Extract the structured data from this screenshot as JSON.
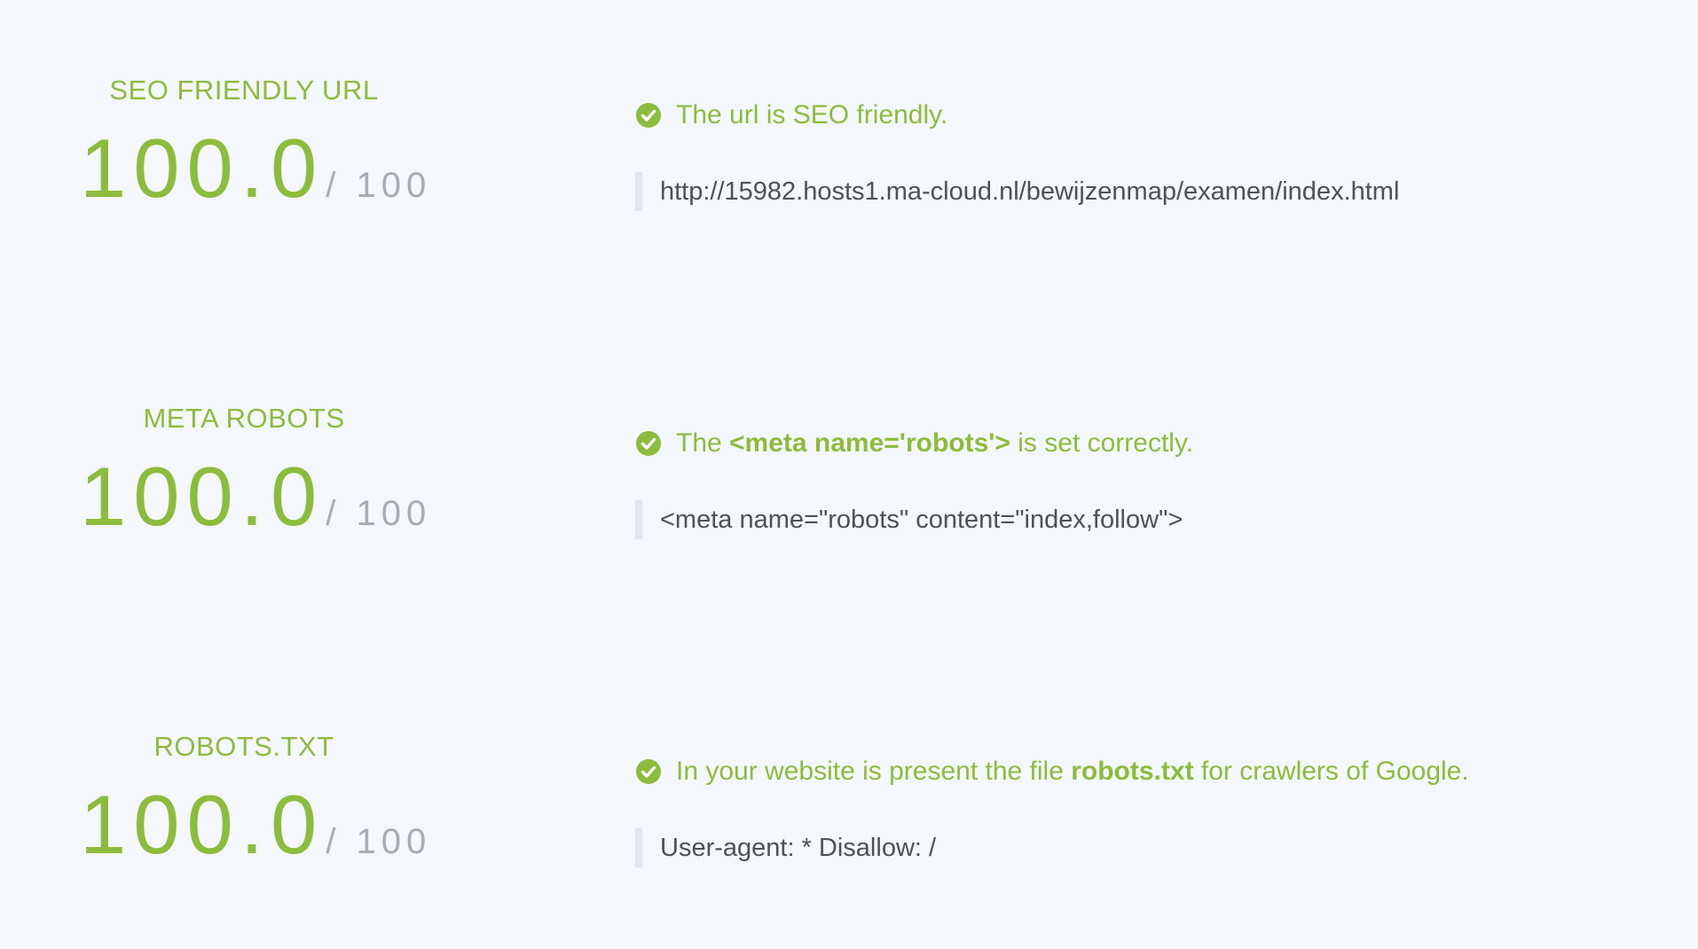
{
  "sections": [
    {
      "title": "SEO FRIENDLY URL",
      "score": "100.0",
      "max": "/ 100",
      "status": {
        "prefix": "The url is SEO friendly.",
        "bold": "",
        "suffix": ""
      },
      "code": "http://15982.hosts1.ma-cloud.nl/bewijzenmap/examen/index.html"
    },
    {
      "title": "META ROBOTS",
      "score": "100.0",
      "max": "/ 100",
      "status": {
        "prefix": "The ",
        "bold": "<meta name='robots'>",
        "suffix": " is set correctly."
      },
      "code": "<meta name=\"robots\" content=\"index,follow\">"
    },
    {
      "title": "ROBOTS.TXT",
      "score": "100.0",
      "max": "/ 100",
      "status": {
        "prefix": "In your website is present the file ",
        "bold": "robots.txt",
        "suffix": " for crawlers of Google."
      },
      "code": "User-agent: * Disallow: /"
    }
  ],
  "colors": {
    "accent": "#8cbc3c",
    "muted": "#a6adb5",
    "background": "#f4f7fb",
    "code_border": "#dfe6f0"
  },
  "icons": {
    "status": "check-circle-icon"
  }
}
